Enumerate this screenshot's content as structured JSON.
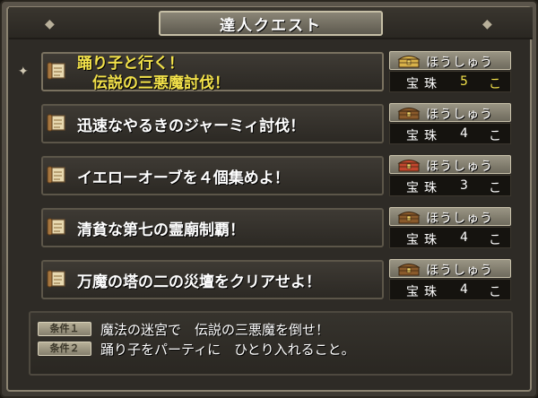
{
  "window": {
    "title": "達人クエスト"
  },
  "quests": [
    {
      "title_lines": [
        "踊り子と行く！",
        "　伝説の三悪魔討伐！"
      ],
      "selected": true,
      "reward_label": "ほうしゅう",
      "reward_item": "宝珠",
      "reward_qty": "5",
      "reward_unit": "こ",
      "chest": "gold"
    },
    {
      "title_lines": [
        "迅速なやるきのジャーミィ討伐！"
      ],
      "selected": false,
      "reward_label": "ほうしゅう",
      "reward_item": "宝珠",
      "reward_qty": "4",
      "reward_unit": "こ",
      "chest": "brown"
    },
    {
      "title_lines": [
        "イエローオーブを４個集めよ！"
      ],
      "selected": false,
      "reward_label": "ほうしゅう",
      "reward_item": "宝珠",
      "reward_qty": "3",
      "reward_unit": "こ",
      "chest": "red"
    },
    {
      "title_lines": [
        "清貧な第七の霊廟制覇！"
      ],
      "selected": false,
      "reward_label": "ほうしゅう",
      "reward_item": "宝珠",
      "reward_qty": "4",
      "reward_unit": "こ",
      "chest": "brown"
    },
    {
      "title_lines": [
        "万魔の塔の二の災壇をクリアせよ！"
      ],
      "selected": false,
      "reward_label": "ほうしゅう",
      "reward_item": "宝珠",
      "reward_qty": "4",
      "reward_unit": "こ",
      "chest": "brown"
    }
  ],
  "conditions": [
    {
      "label": "条件１",
      "text": "魔法の迷宮で　伝説の三悪魔を倒せ！"
    },
    {
      "label": "条件２",
      "text": "踊り子をパーティに　ひとり入れること。"
    }
  ],
  "colors": {
    "selected_text": "#f3e24a",
    "normal_text": "#ffffff",
    "chest_gold": "#d9b24a",
    "chest_brown": "#8a5a2b",
    "chest_red": "#c2462e"
  }
}
